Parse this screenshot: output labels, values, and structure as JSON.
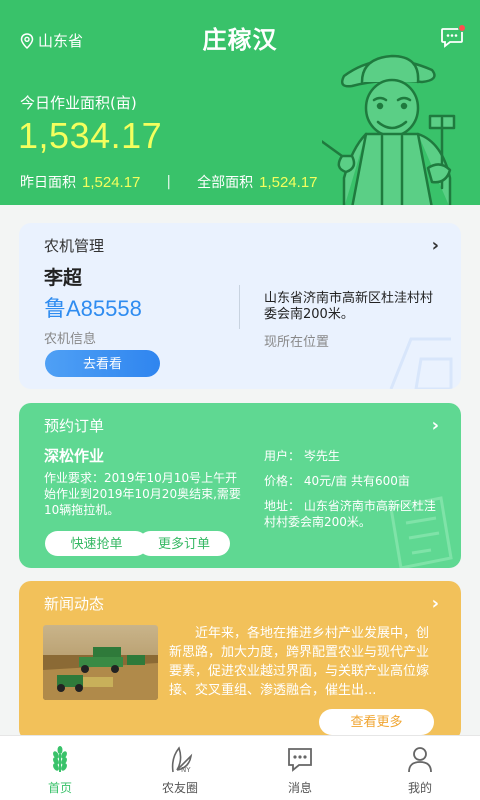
{
  "header": {
    "location": "山东省",
    "title": "庄稼汉",
    "today_label": "今日作业面积(亩)",
    "today_value": "1,534.17",
    "yesterday_label": "昨日面积",
    "yesterday_value": "1,524.17",
    "total_label": "全部面积",
    "total_value": "1,524.17"
  },
  "machine_card": {
    "heading": "农机管理",
    "operator": "李超",
    "plate": "鲁A85558",
    "info_label": "农机信息",
    "address": "山东省济南市高新区杜洼村村委会南200米。",
    "position_label": "现所在位置",
    "button": "去看看"
  },
  "order_card": {
    "heading": "预约订单",
    "subtitle": "深松作业",
    "requirement": "作业要求：2019年10月10号上午开始作业到2019年10月20奥结束,需要10辆拖拉机。",
    "user": "用户：  岑先生",
    "price": "价格：  40元/亩 共有600亩",
    "address": "地址：  山东省济南市高新区杜洼村村委会南200米。",
    "grab_button": "快速抢单",
    "more_button": "更多订单"
  },
  "news_card": {
    "heading": "新闻动态",
    "text": "近年来，各地在推进乡村产业发展中，创新思路，加大力度，跨界配置农业与现代产业要素，促进农业越过界面，与关联产业高位嫁接、交叉重组、渗透融合，催生出...",
    "more_button": "查看更多"
  },
  "tabs": [
    {
      "label": "首页",
      "icon": "wheat-icon"
    },
    {
      "label": "农友圈",
      "icon": "leaf-icon"
    },
    {
      "label": "消息",
      "icon": "chat-icon"
    },
    {
      "label": "我的",
      "icon": "user-icon"
    }
  ],
  "colors": {
    "primary_green": "#39c26a",
    "highlight_yellow": "#f4ff5e",
    "machine_bg": "#eaf2fe",
    "order_bg": "#5fd892",
    "news_bg": "#f2c15a",
    "link_blue": "#2f8cf0"
  }
}
